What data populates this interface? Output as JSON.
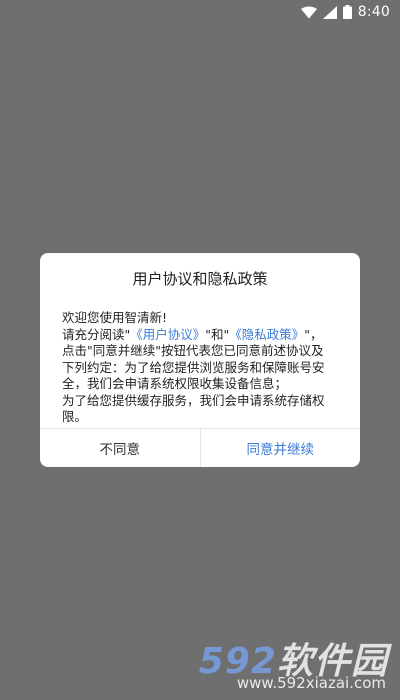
{
  "status_bar": {
    "time": "8:40",
    "icons": [
      "wifi-icon",
      "signal-icon",
      "battery-icon"
    ]
  },
  "dialog": {
    "title": "用户协议和隐私政策",
    "body": {
      "line1": "欢迎您使用智清新!",
      "line2_prefix": "请充分阅读",
      "q1": "\"",
      "link_user_agreement": "《用户协议》",
      "mid_text": "\"和\"",
      "link_privacy_policy": "《隐私政策》",
      "q2": "\"，",
      "line3": "点击\"同意并继续\"按钮代表您已同意前述协议及",
      "line4": "下列约定：为了给您提供浏览服务和保障账号安",
      "line5": "全，我们会申请系统权限收集设备信息；",
      "line6": "为了给您提供缓存服务，我们会申请系统存储权",
      "line7": "限。"
    },
    "buttons": {
      "disagree": "不同意",
      "agree": "同意并继续"
    }
  },
  "watermark": {
    "logo_number": "592",
    "logo_text": "软件园",
    "url": "www.592xiazai.com"
  },
  "colors": {
    "background": "#6f6f6f",
    "link": "#3a7bd5",
    "dialog_bg": "#ffffff"
  }
}
